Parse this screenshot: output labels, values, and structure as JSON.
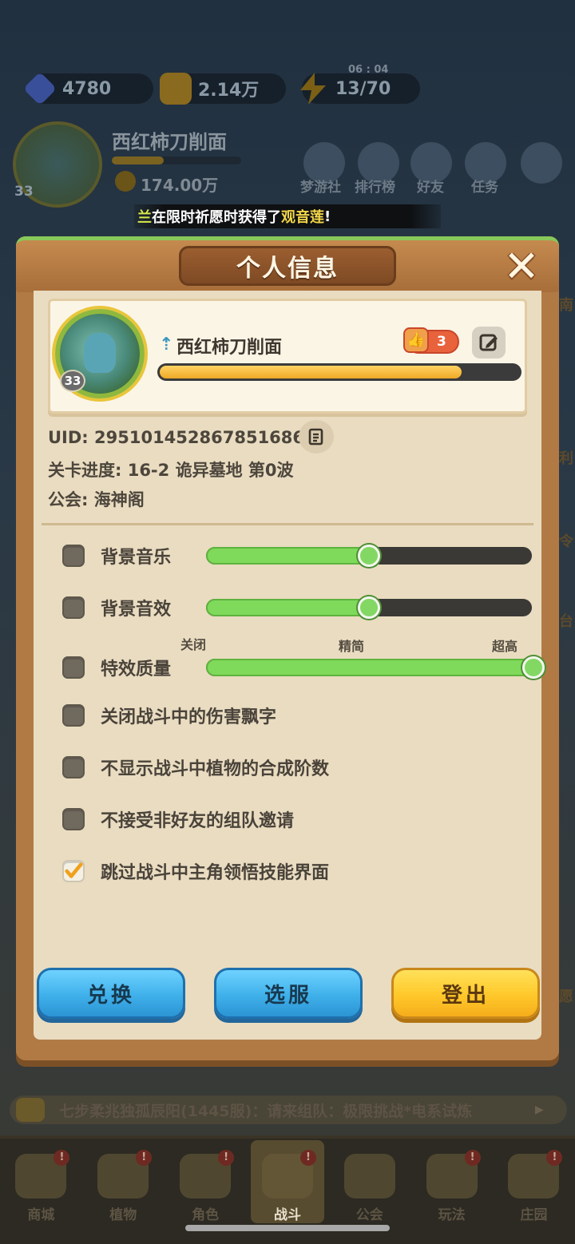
{
  "hud": {
    "gems": "4780",
    "gold": "2.14万",
    "energy": "13/70",
    "energy_timer": "06 : 04",
    "player_name": "西红柿刀削面",
    "player_level": "33",
    "power": "174.00万",
    "top_menu": [
      "梦游社",
      "排行榜",
      "好友",
      "任务"
    ],
    "right_side_labels": [
      "南",
      "利",
      "令",
      "台",
      "愿"
    ]
  },
  "banner": {
    "prefix": "兰",
    "text": "在限时祈愿时获得了",
    "highlight": "观音莲",
    "suffix": "!"
  },
  "modal": {
    "title": "个人信息",
    "profile": {
      "name": "西红柿刀削面",
      "level": "33",
      "likes": "3",
      "exp_progress_pct": 84
    },
    "uid_line": "UID: 295101452867851686",
    "stage_line": "关卡进度: 16-2  诡异墓地 第0波",
    "guild_line": "公会: 海神阁",
    "settings": {
      "bgm": {
        "label": "背景音乐",
        "checked": false,
        "volume_pct": 50
      },
      "sfx": {
        "label": "背景音效",
        "checked": false,
        "volume_pct": 50
      },
      "quality": {
        "label": "特效质量",
        "checked": false,
        "level_pct": 100,
        "ticks": [
          "关闭",
          "精简",
          "超高"
        ]
      },
      "toggles": [
        {
          "label": "关闭战斗中的伤害飘字",
          "checked": false
        },
        {
          "label": "不显示战斗中植物的合成阶数",
          "checked": false
        },
        {
          "label": "不接受非好友的组队邀请",
          "checked": false
        },
        {
          "label": "跳过战斗中主角领悟技能界面",
          "checked": true
        }
      ]
    },
    "buttons": {
      "redeem": "兑换",
      "server": "选服",
      "logout": "登出"
    }
  },
  "chat": {
    "text": "七步柔兆独孤辰阳(1445服)：请来组队：极限挑战*电系试炼",
    "arrow": "▶"
  },
  "bottom_nav": {
    "items": [
      {
        "label": "商城",
        "badge": "!"
      },
      {
        "label": "植物",
        "badge": "!"
      },
      {
        "label": "角色",
        "badge": "!"
      },
      {
        "label": "战斗",
        "badge": "!",
        "active": true
      },
      {
        "label": "公会",
        "badge": ""
      },
      {
        "label": "玩法",
        "badge": "!"
      },
      {
        "label": "庄园",
        "badge": "!"
      }
    ]
  },
  "colors": {
    "accent_green": "#7fd95b",
    "button_blue": "#3fb0ea",
    "button_yellow": "#ffc82a",
    "exp_bar": "#f0a927",
    "modal_wood": "#b17a44",
    "paper": "#e9dcc1"
  }
}
